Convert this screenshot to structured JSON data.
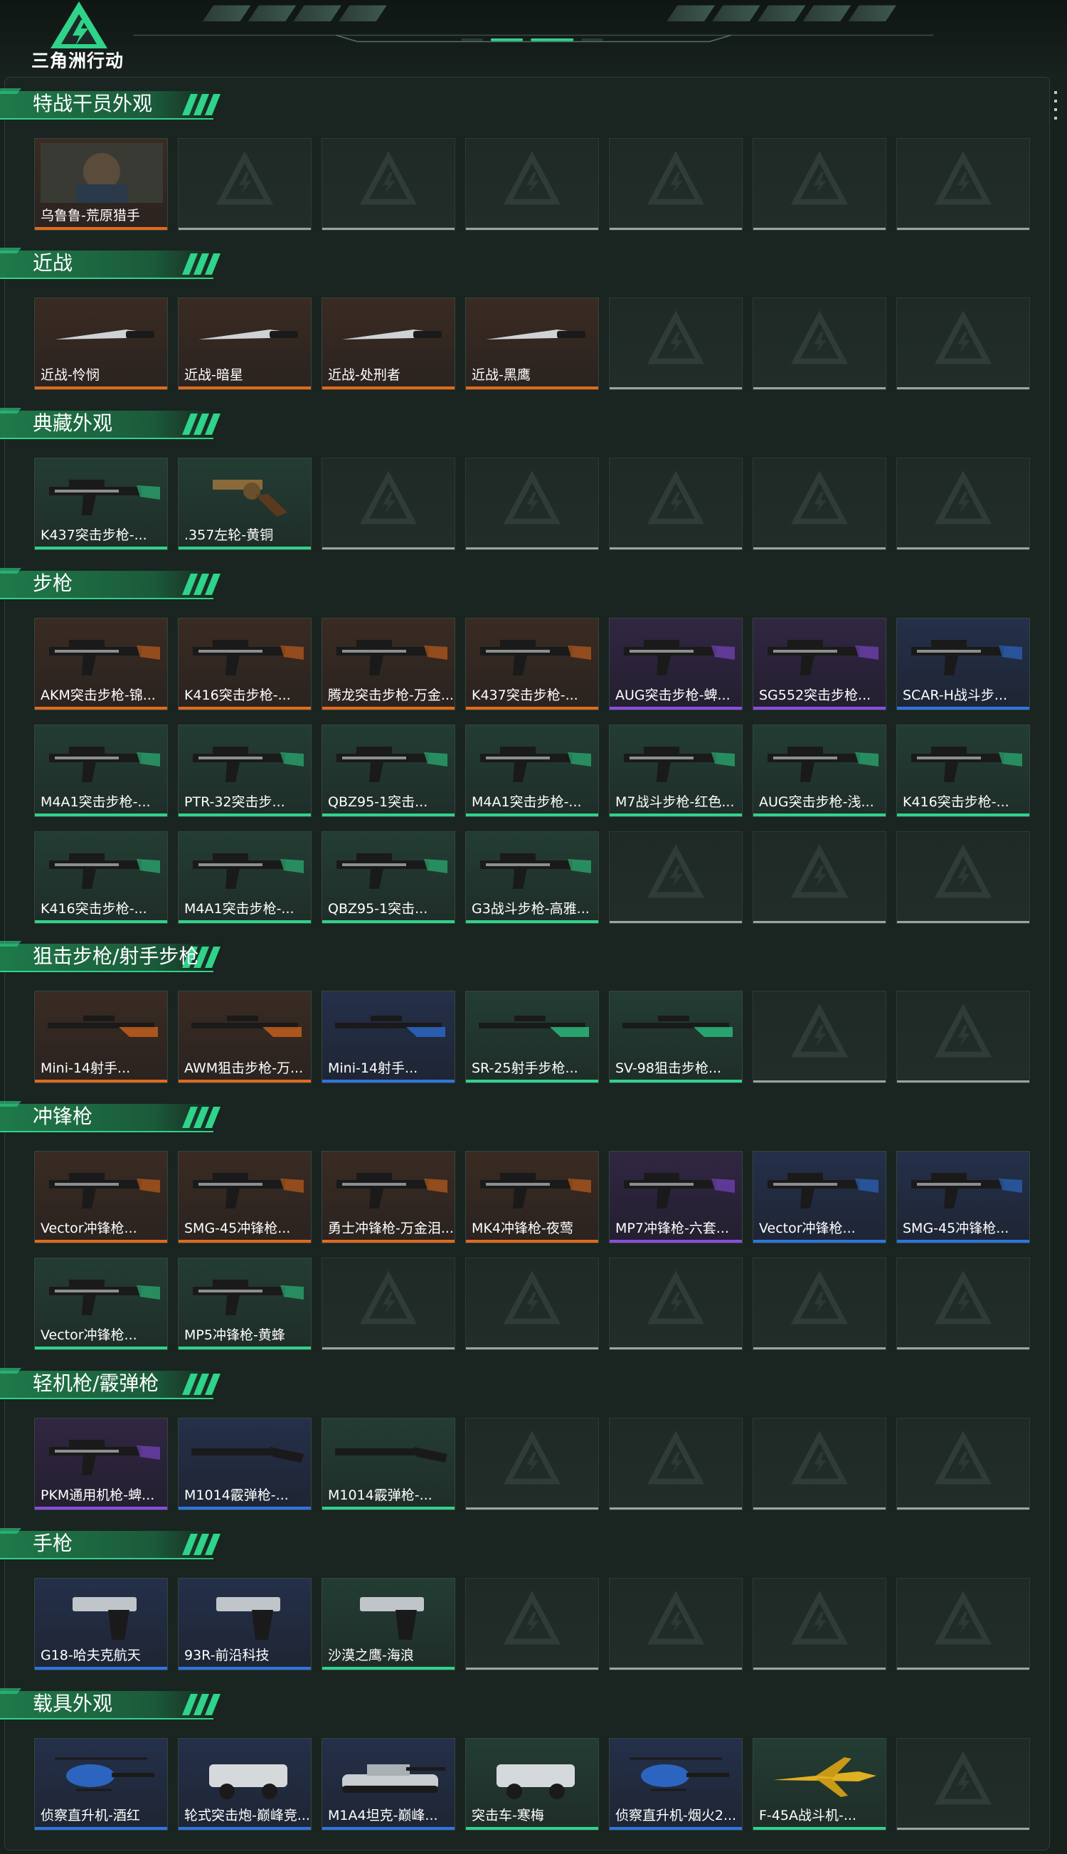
{
  "header": {
    "logo_text": "三角洲行动",
    "accent": "#2fd38a"
  },
  "quality_colors": {
    "orange": "#e06a1c",
    "purple": "#8a4de0",
    "blue": "#2f74e0",
    "green": "#2fd38a",
    "empty": "#9aa5a0"
  },
  "sections": [
    {
      "title": "特战干员外观",
      "rows": [
        [
          {
            "label": "乌鲁鲁-荒原猎手",
            "quality": "orange",
            "icon": "operator-portrait-icon"
          },
          null,
          null,
          null,
          null,
          null,
          null
        ]
      ]
    },
    {
      "title": "近战",
      "rows": [
        [
          {
            "label": "近战-怜悯",
            "quality": "orange",
            "icon": "knife-icon"
          },
          {
            "label": "近战-暗星",
            "quality": "orange",
            "icon": "knife-icon"
          },
          {
            "label": "近战-处刑者",
            "quality": "orange",
            "icon": "knife-icon"
          },
          {
            "label": "近战-黑鹰",
            "quality": "orange",
            "icon": "knife-icon"
          },
          null,
          null,
          null
        ]
      ]
    },
    {
      "title": "典藏外观",
      "rows": [
        [
          {
            "label": "K437突击步枪-...",
            "quality": "green",
            "icon": "rifle-icon"
          },
          {
            "label": ".357左轮-黄铜",
            "quality": "green",
            "icon": "revolver-icon"
          },
          null,
          null,
          null,
          null,
          null
        ]
      ]
    },
    {
      "title": "步枪",
      "rows": [
        [
          {
            "label": "AKM突击步枪-锦...",
            "quality": "orange",
            "icon": "rifle-icon"
          },
          {
            "label": "K416突击步枪-...",
            "quality": "orange",
            "icon": "rifle-icon"
          },
          {
            "label": "腾龙突击步枪-万金...",
            "quality": "orange",
            "icon": "rifle-icon"
          },
          {
            "label": "K437突击步枪-...",
            "quality": "orange",
            "icon": "rifle-icon"
          },
          {
            "label": "AUG突击步枪-蜱...",
            "quality": "purple",
            "icon": "rifle-icon"
          },
          {
            "label": "SG552突击步枪...",
            "quality": "purple",
            "icon": "rifle-icon"
          },
          {
            "label": "SCAR-H战斗步...",
            "quality": "blue",
            "icon": "rifle-icon"
          }
        ],
        [
          {
            "label": "M4A1突击步枪-...",
            "quality": "green",
            "icon": "rifle-icon"
          },
          {
            "label": "PTR-32突击步...",
            "quality": "green",
            "icon": "rifle-icon"
          },
          {
            "label": "QBZ95-1突击...",
            "quality": "green",
            "icon": "rifle-icon"
          },
          {
            "label": "M4A1突击步枪-...",
            "quality": "green",
            "icon": "rifle-icon"
          },
          {
            "label": "M7战斗步枪-红色...",
            "quality": "green",
            "icon": "rifle-icon"
          },
          {
            "label": "AUG突击步枪-浅...",
            "quality": "green",
            "icon": "rifle-icon"
          },
          {
            "label": "K416突击步枪-...",
            "quality": "green",
            "icon": "rifle-icon"
          }
        ],
        [
          {
            "label": "K416突击步枪-...",
            "quality": "green",
            "icon": "rifle-icon"
          },
          {
            "label": "M4A1突击步枪-...",
            "quality": "green",
            "icon": "rifle-icon"
          },
          {
            "label": "QBZ95-1突击...",
            "quality": "green",
            "icon": "rifle-icon"
          },
          {
            "label": "G3战斗步枪-高雅...",
            "quality": "green",
            "icon": "rifle-icon"
          },
          null,
          null,
          null
        ]
      ]
    },
    {
      "title": "狙击步枪/射手步枪",
      "rows": [
        [
          {
            "label": "Mini-14射手...",
            "quality": "orange",
            "icon": "sniper-icon"
          },
          {
            "label": "AWM狙击步枪-万...",
            "quality": "orange",
            "icon": "sniper-icon"
          },
          {
            "label": "Mini-14射手...",
            "quality": "blue",
            "icon": "sniper-icon"
          },
          {
            "label": "SR-25射手步枪...",
            "quality": "green",
            "icon": "sniper-icon"
          },
          {
            "label": "SV-98狙击步枪...",
            "quality": "green",
            "icon": "sniper-icon"
          },
          null,
          null
        ]
      ]
    },
    {
      "title": "冲锋枪",
      "rows": [
        [
          {
            "label": "Vector冲锋枪...",
            "quality": "orange",
            "icon": "smg-icon"
          },
          {
            "label": "SMG-45冲锋枪...",
            "quality": "orange",
            "icon": "smg-icon"
          },
          {
            "label": "勇士冲锋枪-万金泪...",
            "quality": "orange",
            "icon": "smg-icon"
          },
          {
            "label": "MK4冲锋枪-夜莺",
            "quality": "orange",
            "icon": "smg-icon"
          },
          {
            "label": "MP7冲锋枪-六套...",
            "quality": "purple",
            "icon": "smg-icon"
          },
          {
            "label": "Vector冲锋枪...",
            "quality": "blue",
            "icon": "smg-icon"
          },
          {
            "label": "SMG-45冲锋枪...",
            "quality": "blue",
            "icon": "smg-icon"
          }
        ],
        [
          {
            "label": "Vector冲锋枪...",
            "quality": "green",
            "icon": "smg-icon"
          },
          {
            "label": "MP5冲锋枪-黄蜂",
            "quality": "green",
            "icon": "smg-icon"
          },
          null,
          null,
          null,
          null,
          null
        ]
      ]
    },
    {
      "title": "轻机枪/霰弹枪",
      "rows": [
        [
          {
            "label": "PKM通用机枪-蜱...",
            "quality": "purple",
            "icon": "machinegun-icon"
          },
          {
            "label": "M1014霰弹枪-...",
            "quality": "blue",
            "icon": "shotgun-icon"
          },
          {
            "label": "M1014霰弹枪-...",
            "quality": "green",
            "icon": "shotgun-icon"
          },
          null,
          null,
          null,
          null
        ]
      ]
    },
    {
      "title": "手枪",
      "rows": [
        [
          {
            "label": "G18-哈夫克航天",
            "quality": "blue",
            "icon": "pistol-icon"
          },
          {
            "label": "93R-前沿科技",
            "quality": "blue",
            "icon": "pistol-icon"
          },
          {
            "label": "沙漠之鹰-海浪",
            "quality": "green",
            "icon": "pistol-icon"
          },
          null,
          null,
          null,
          null
        ]
      ]
    },
    {
      "title": "载具外观",
      "rows": [
        [
          {
            "label": "侦察直升机-酒红",
            "quality": "blue",
            "icon": "helicopter-icon"
          },
          {
            "label": "轮式突击炮-巅峰竞...",
            "quality": "blue",
            "icon": "assault-vehicle-icon"
          },
          {
            "label": "M1A4坦克-巅峰...",
            "quality": "blue",
            "icon": "tank-icon"
          },
          {
            "label": "突击车-寒梅",
            "quality": "green",
            "icon": "assault-vehicle-icon"
          },
          {
            "label": "侦察直升机-烟火2...",
            "quality": "blue",
            "icon": "helicopter-icon"
          },
          {
            "label": "F-45A战斗机-...",
            "quality": "green",
            "icon": "jet-icon"
          },
          null
        ]
      ]
    }
  ]
}
